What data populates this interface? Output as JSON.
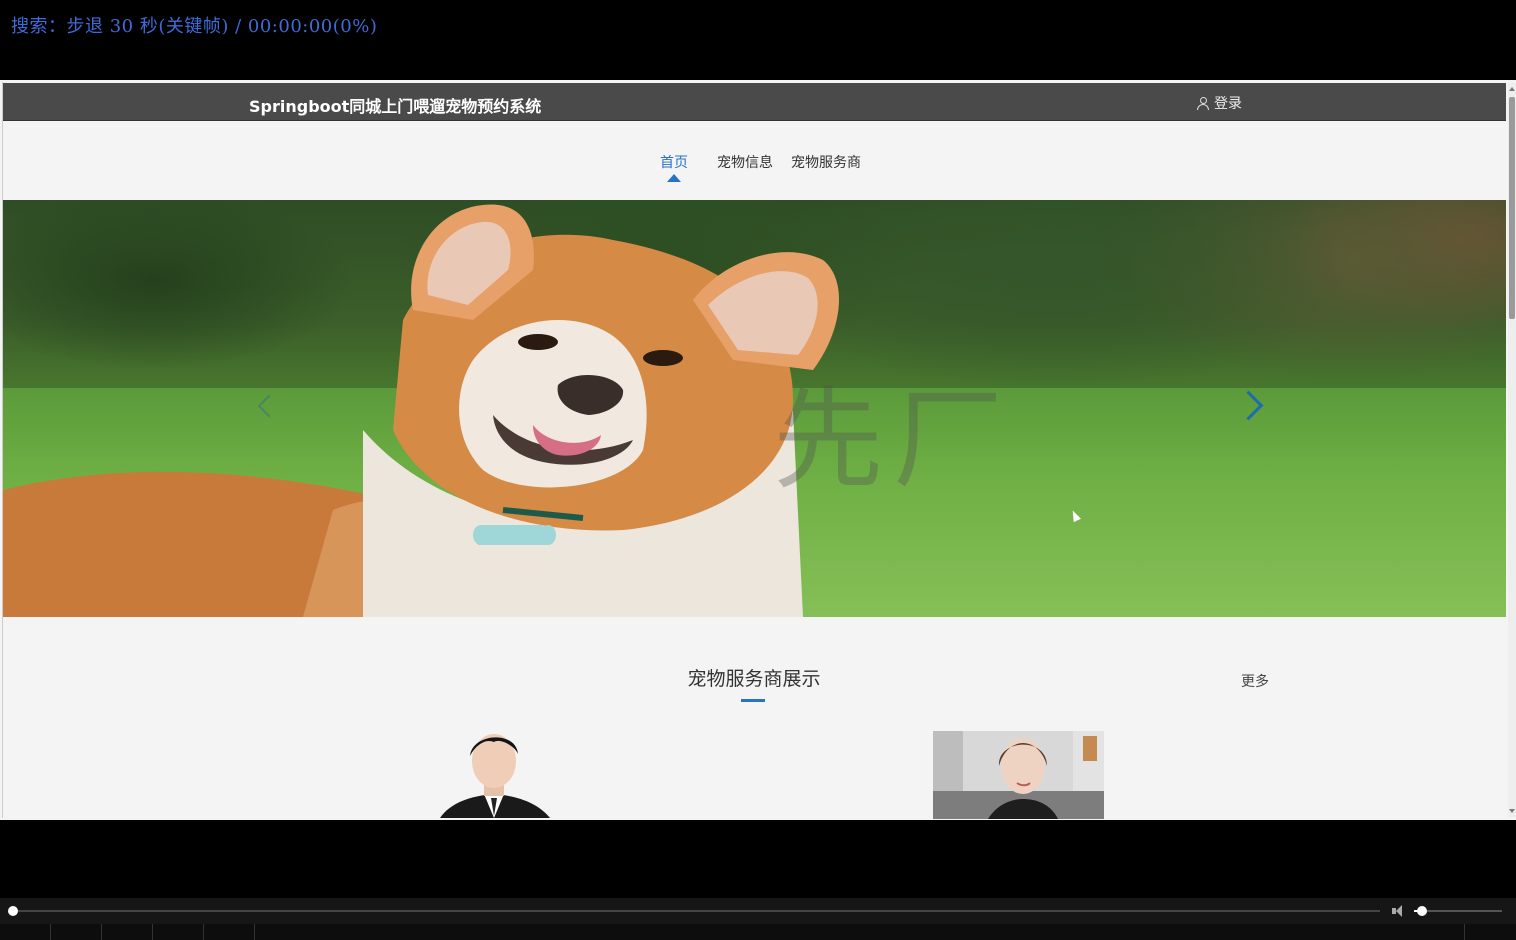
{
  "osd": {
    "text": "搜索：步退 30 秒(关键帧) / 00:00:00(0%)"
  },
  "site": {
    "title": "Springboot同城上门喂遛宠物预约系统",
    "login_label": "登录"
  },
  "nav": {
    "items": [
      {
        "label": "首页",
        "active": true
      },
      {
        "label": "宠物信息",
        "active": false
      },
      {
        "label": "宠物服务商",
        "active": false
      }
    ]
  },
  "banner": {
    "watermark": "先厂"
  },
  "section": {
    "title": "宠物服务商展示",
    "more_label": "更多"
  },
  "player": {
    "progress": 0.0,
    "volume": 0.06
  },
  "colors": {
    "accent": "#2a72c6",
    "osd_text": "#3f6ad8",
    "topbar": "#4a4a4a"
  },
  "icons": {
    "login": "user-icon",
    "next": "chevron-right-icon",
    "prev": "chevron-left-icon",
    "volume": "speaker-icon"
  }
}
